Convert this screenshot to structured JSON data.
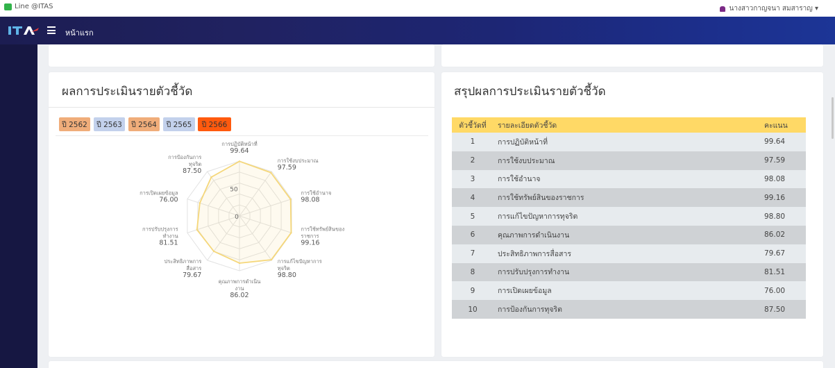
{
  "topbar": {
    "line_label": "Line @ITAS",
    "user_name": "นางสาวกาญจนา สมสาราญ ▾"
  },
  "navbar": {
    "logo_text": "ITA",
    "title": "หน้าแรก"
  },
  "left_card": {
    "title": "ผลการประเมินรายตัวชี้วัด",
    "years": [
      {
        "label": "ปี 2562",
        "color": "#f0ad7a"
      },
      {
        "label": "ปี 2563",
        "color": "#c3d1ec"
      },
      {
        "label": "ปี 2564",
        "color": "#f0ad7a"
      },
      {
        "label": "ปี 2565",
        "color": "#c3d1ec"
      },
      {
        "label": "ปี 2566",
        "color": "#ff5a0e"
      }
    ]
  },
  "chart_data": {
    "type": "radar",
    "series": [
      {
        "values": [
          99.64,
          97.59,
          98.08,
          99.16,
          98.8,
          86.02,
          79.67,
          81.51,
          76.0,
          87.5
        ],
        "color": "#f5d77a"
      }
    ],
    "axes": [
      {
        "label": [
          "การปฏิบัติหน้าที่"
        ],
        "value": "99.64"
      },
      {
        "label": [
          "การใช้งบประมาณ"
        ],
        "value": "97.59"
      },
      {
        "label": [
          "การใช้อำนาจ"
        ],
        "value": "98.08"
      },
      {
        "label": [
          "การใช้ทรัพย์สินของ",
          "ราชการ"
        ],
        "value": "99.16"
      },
      {
        "label": [
          "การแก้ไขปัญหาการ",
          "ทุจริต"
        ],
        "value": "98.80"
      },
      {
        "label": [
          "คุณภาพการดำเนิน",
          "งาน"
        ],
        "value": "86.02"
      },
      {
        "label": [
          "ประสิทธิภาพการ",
          "สื่อสาร"
        ],
        "value": "79.67"
      },
      {
        "label": [
          "การปรับปรุงการ",
          "ทำงาน"
        ],
        "value": "81.51"
      },
      {
        "label": [
          "การเปิดเผยข้อมูล"
        ],
        "value": "76.00"
      },
      {
        "label": [
          "การป้องกันการ",
          "ทุจริต"
        ],
        "value": "87.50"
      }
    ],
    "ticks": [
      "0",
      "50"
    ],
    "range": [
      0,
      100
    ]
  },
  "right_card": {
    "title": "สรุปผลการประเมินรายตัวชี้วัด",
    "columns": [
      "ตัวชี้วัดที่",
      "รายละเอียดตัวชี้วัด",
      "คะแนน"
    ],
    "rows": [
      {
        "no": "1",
        "desc": "การปฏิบัติหน้าที่",
        "score": "99.64"
      },
      {
        "no": "2",
        "desc": "การใช้งบประมาณ",
        "score": "97.59"
      },
      {
        "no": "3",
        "desc": "การใช้อำนาจ",
        "score": "98.08"
      },
      {
        "no": "4",
        "desc": "การใช้ทรัพย์สินของราชการ",
        "score": "99.16"
      },
      {
        "no": "5",
        "desc": "การแก้ไขปัญหาการทุจริต",
        "score": "98.80"
      },
      {
        "no": "6",
        "desc": "คุณภาพการดำเนินงาน",
        "score": "86.02"
      },
      {
        "no": "7",
        "desc": "ประสิทธิภาพการสื่อสาร",
        "score": "79.67"
      },
      {
        "no": "8",
        "desc": "การปรับปรุงการทำงาน",
        "score": "81.51"
      },
      {
        "no": "9",
        "desc": "การเปิดเผยข้อมูล",
        "score": "76.00"
      },
      {
        "no": "10",
        "desc": "การป้องกันการทุจริต",
        "score": "87.50"
      }
    ]
  }
}
